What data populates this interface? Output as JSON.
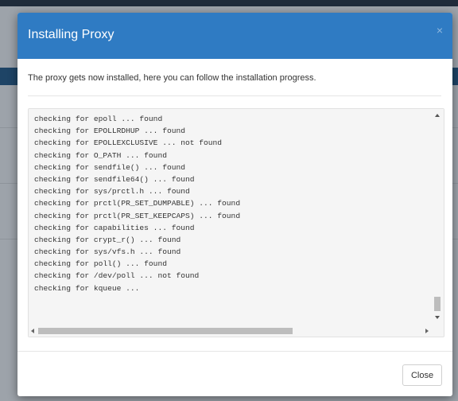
{
  "dialog": {
    "title": "Installing Proxy",
    "close_icon": "×",
    "intro": "The proxy gets now installed, here you can follow the installation progress.",
    "log_lines": [
      "checking for epoll ... found",
      "checking for EPOLLRDHUP ... found",
      "checking for EPOLLEXCLUSIVE ... not found",
      "checking for O_PATH ... found",
      "checking for sendfile() ... found",
      "checking for sendfile64() ... found",
      "checking for sys/prctl.h ... found",
      "checking for prctl(PR_SET_DUMPABLE) ... found",
      "checking for prctl(PR_SET_KEEPCAPS) ... found",
      "checking for capabilities ... found",
      "checking for crypt_r() ... found",
      "checking for sys/vfs.h ... found",
      "checking for poll() ... found",
      "checking for /dev/poll ... not found",
      "checking for kqueue ..."
    ],
    "close_label": "Close"
  }
}
